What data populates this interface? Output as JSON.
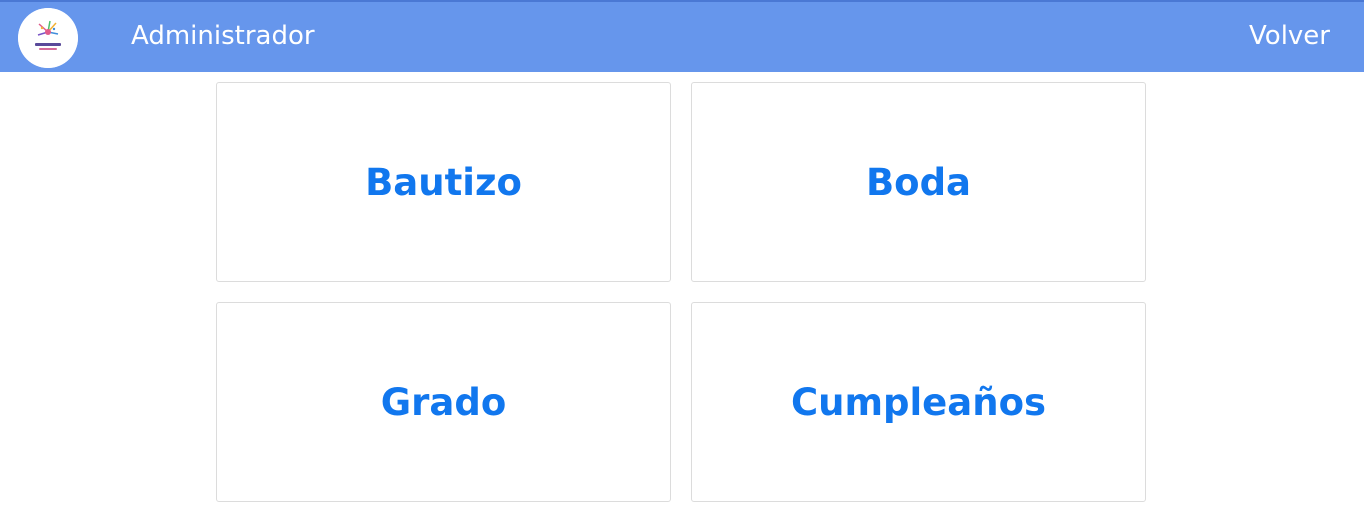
{
  "navbar": {
    "logo_icon": "party-logo-icon",
    "title": "Administrador",
    "back_label": "Volver",
    "background_color": "#6696ec"
  },
  "cards": [
    {
      "label": "Bautizo"
    },
    {
      "label": "Boda"
    },
    {
      "label": "Grado"
    },
    {
      "label": "Cumpleaños"
    }
  ],
  "colors": {
    "card_text": "#1177ee",
    "card_border": "#dcdcdc"
  }
}
